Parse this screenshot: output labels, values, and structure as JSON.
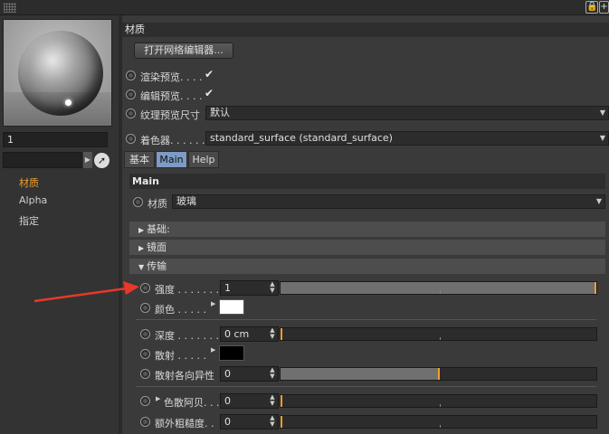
{
  "leftpanel": {
    "preview_value": "1",
    "nav": [
      {
        "label": "材质",
        "active": true
      },
      {
        "label": "Alpha",
        "active": false
      },
      {
        "label": "指定",
        "active": false
      }
    ]
  },
  "header": {
    "title": "材质"
  },
  "node_editor_button": "打开网络编辑器...",
  "options": {
    "render_preview": "渲染预览. . . .",
    "editor_preview": "编辑预览. . . .",
    "texture_preview_size": "纹理预览尺寸",
    "texture_preview_value": "默认",
    "shader": "着色器. . . . . . .",
    "shader_value": "standard_surface (standard_surface)"
  },
  "tabs": [
    {
      "label": "基本",
      "selected": false
    },
    {
      "label": "Main",
      "selected": true
    },
    {
      "label": "Help",
      "selected": false
    }
  ],
  "main": {
    "title": "Main",
    "material_label": "材质",
    "material_value": "玻璃",
    "sections": [
      "基础:",
      "镜面",
      "传输"
    ]
  },
  "transmission": {
    "strength_label": "强度 . . . . . . . .",
    "strength_value": "1",
    "strength_level": 1.0,
    "color_label": "颜色 . . . . .",
    "color_value": "#ffffff",
    "depth_label": "深度 . . . . . . . .",
    "depth_value": "0 cm",
    "scatter_label": "散射 . . . . .",
    "scatter_color": "#000000",
    "anisotropy_label": "散射各向异性",
    "anisotropy_value": "0",
    "anisotropy_level": 0.5,
    "dispersion_label": "色散阿贝. . .",
    "dispersion_value": "0",
    "extra_roughness_label": "额外粗糙度. .",
    "extra_roughness_value": "0"
  },
  "colors": {
    "accent": "#f0a030",
    "arrow": "#e8382a",
    "tab_selected": "#7d9bc4"
  }
}
